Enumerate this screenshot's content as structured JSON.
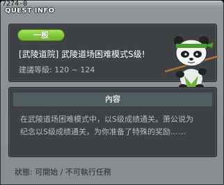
{
  "window": {
    "quest_id": "7274-0",
    "title": "QUEST INFO"
  },
  "quest": {
    "category": "一般",
    "name": "[武陵道院] 武陵道场困难模式S级!",
    "level_label": "建議等級:",
    "level_range": "120 ~ 124"
  },
  "content": {
    "header": "內容",
    "lines": [
      "在武陵道场困难模式中，以S级成绩通关。萧公说为",
      "纪念以S级成绩通关，为你准备了特殊的奖励……"
    ]
  },
  "status": {
    "label": "狀態:",
    "value": "可開始 / 不可執行任務"
  },
  "npc": {
    "icon": "panda-npc-icon"
  },
  "colors": {
    "tag_green": "#8ccc42",
    "panel_bg": "#3e4245",
    "header_bg": "#505c62"
  }
}
